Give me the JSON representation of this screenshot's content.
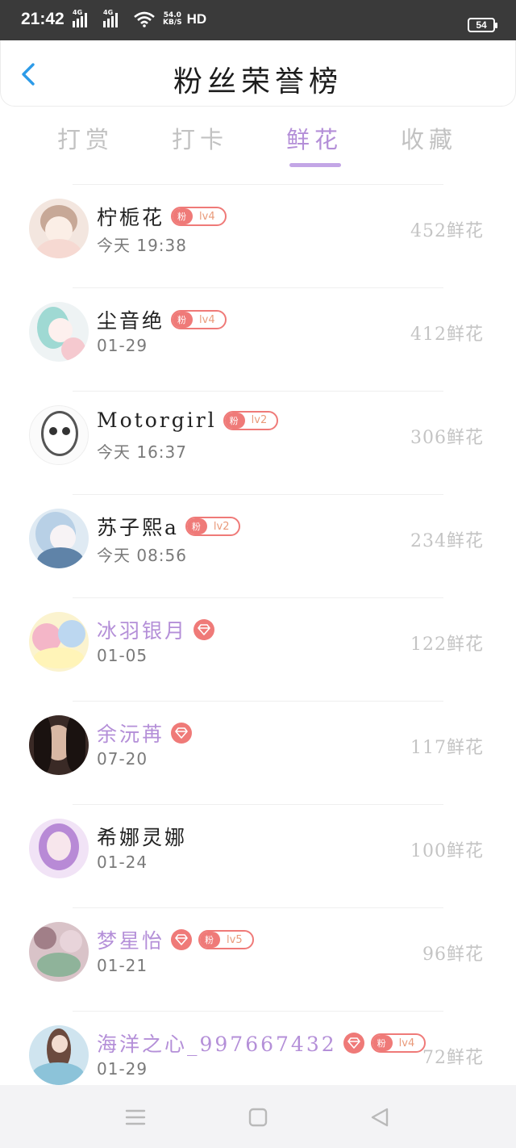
{
  "status_bar": {
    "time": "21:42",
    "net1": "4G",
    "net2": "4G",
    "speed_value": "54.0",
    "speed_unit": "KB/S",
    "hd": "HD",
    "battery": "54"
  },
  "header": {
    "title": "粉丝荣誉榜"
  },
  "tabs": [
    {
      "label": "打赏"
    },
    {
      "label": "打卡"
    },
    {
      "label": "鲜花",
      "active": true
    },
    {
      "label": "收藏"
    }
  ],
  "fans": [
    {
      "name": "柠栀花",
      "date": "今天 19:38",
      "count": "452鲜花",
      "vip": false,
      "badge_fan": "粉",
      "badge_level": "lv4"
    },
    {
      "name": "尘音绝",
      "date": "01-29",
      "count": "412鲜花",
      "vip": false,
      "badge_fan": "粉",
      "badge_level": "lv4"
    },
    {
      "name": "Motorgirl",
      "date": "今天 16:37",
      "count": "306鲜花",
      "vip": false,
      "badge_fan": "粉",
      "badge_level": "lv2"
    },
    {
      "name": "苏子熙a",
      "date": "今天 08:56",
      "count": "234鲜花",
      "vip": false,
      "badge_fan": "粉",
      "badge_level": "lv2"
    },
    {
      "name": "冰羽银月",
      "date": "01-05",
      "count": "122鲜花",
      "vip": true
    },
    {
      "name": "余沅苒",
      "date": "07-20",
      "count": "117鲜花",
      "vip": true
    },
    {
      "name": "希娜灵娜",
      "date": "01-24",
      "count": "100鲜花",
      "vip": false
    },
    {
      "name": "梦星怡",
      "date": "01-21",
      "count": "96鲜花",
      "vip": true,
      "badge_fan": "粉",
      "badge_level": "lv5"
    },
    {
      "name": "海洋之心_997667432",
      "date": "01-29",
      "count": "72鲜花",
      "vip": true,
      "badge_fan": "粉",
      "badge_level": "lv4"
    }
  ],
  "colors": {
    "accent": "#b48fd8",
    "badge": "#ef7a78",
    "back_arrow": "#2d9be8"
  }
}
